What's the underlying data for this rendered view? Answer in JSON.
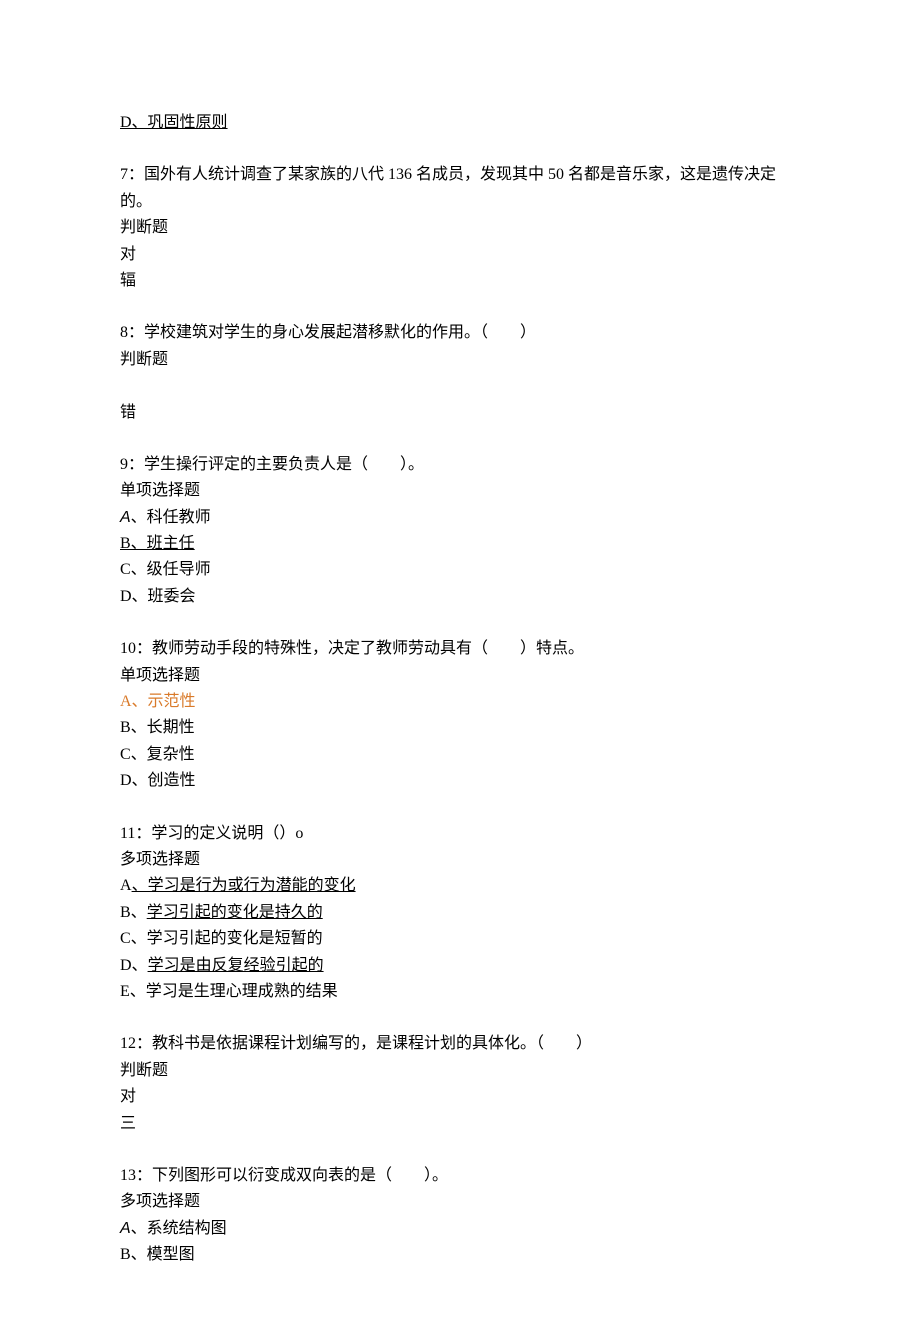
{
  "q6d": "D、巩固性原则",
  "q7": {
    "stem": "7：国外有人统计调查了某家族的八代 136 名成员，发现其中 50 名都是音乐家，这是遗传决定的。",
    "type": "判断题",
    "opt1": "对",
    "opt2": "辐"
  },
  "q8": {
    "stem": "8：学校建筑对学生的身心发展起潜移默化的作用。（　　）",
    "type": "判断题",
    "opt2": "错"
  },
  "q9": {
    "stem": "9：学生操行评定的主要负责人是（　　）。",
    "type": "单项选择题",
    "a_prefix": "A",
    "a_rest": "、科任教师",
    "b": "B、班主任",
    "c": "C、级任导师",
    "d": "D、班委会"
  },
  "q10": {
    "stem": "10：教师劳动手段的特殊性，决定了教师劳动具有（　　）特点。",
    "type": "单项选择题",
    "a": "A、示范性",
    "b": "B、长期性",
    "c": "C、复杂性",
    "d": "D、创造性"
  },
  "q11": {
    "stem": "11：学习的定义说明（）o",
    "type": "多项选择题",
    "a_prefix": "A",
    "a_rest": "、学习是行为或行为潜能的变化",
    "b_prefix": "B、",
    "b_rest": "学习引起的变化是持久的",
    "c": "C、学习引起的变化是短暂的",
    "d_prefix": "D、",
    "d_rest": "学习是由反复经验引起的",
    "e": "E、学习是生理心理成熟的结果"
  },
  "q12": {
    "stem": "12：教科书是依据课程计划编写的，是课程计划的具体化。（　　）",
    "type": "判断题",
    "opt1": "对",
    "opt2": "三"
  },
  "q13": {
    "stem": "13：下列图形可以衍变成双向表的是（　　）。",
    "type": "多项选择题",
    "a_prefix": "A",
    "a_rest": "、系统结构图",
    "b": "B、模型图"
  }
}
